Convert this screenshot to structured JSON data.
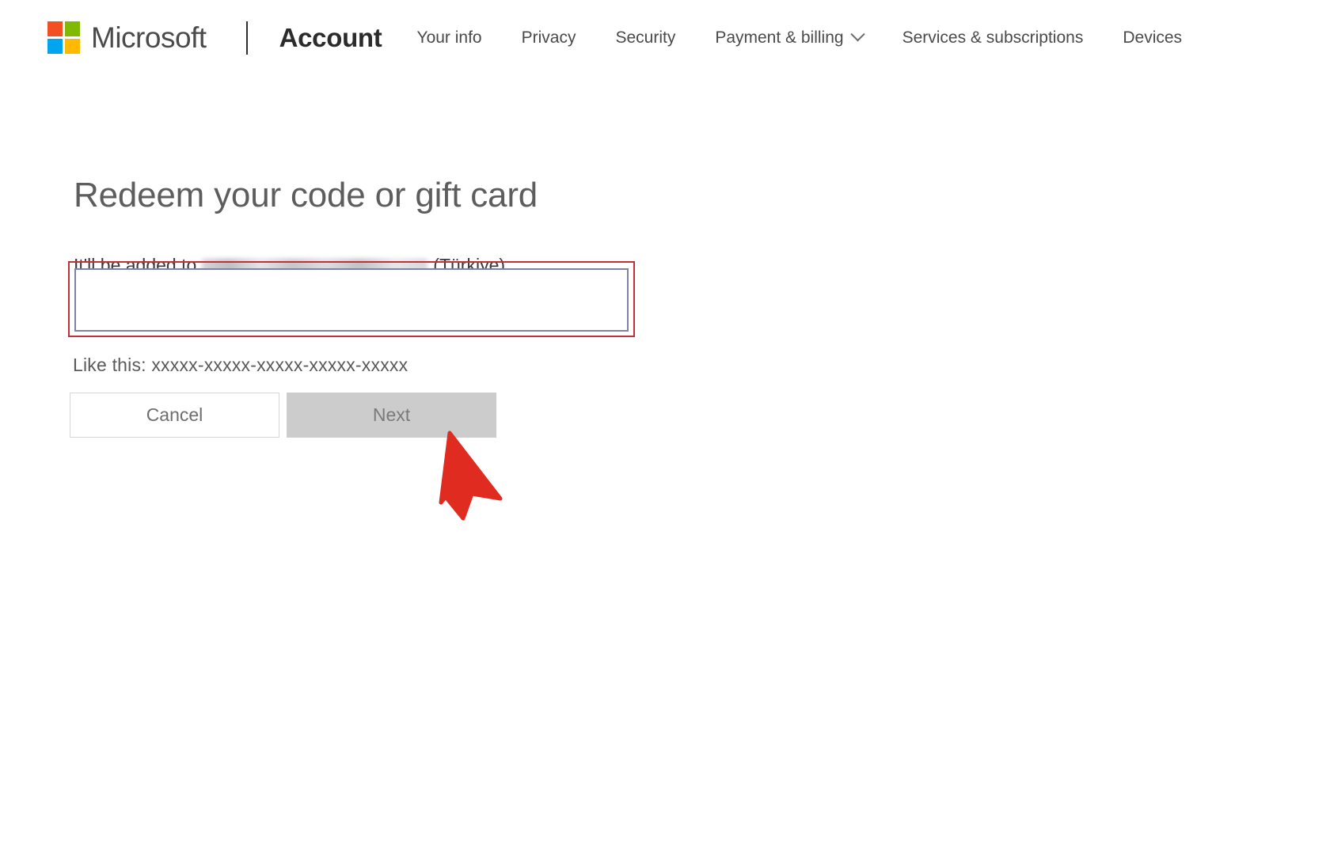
{
  "header": {
    "logo_name": "Microsoft",
    "brand_label": "Microsoft",
    "app_title": "Account",
    "logo_colors": {
      "top_left": "#f25022",
      "top_right": "#7fba00",
      "bottom_left": "#00a4ef",
      "bottom_right": "#ffb900"
    },
    "nav_items": [
      {
        "label": "Your info",
        "has_chevron": false
      },
      {
        "label": "Privacy",
        "has_chevron": false
      },
      {
        "label": "Security",
        "has_chevron": false
      },
      {
        "label": "Payment & billing",
        "has_chevron": true
      },
      {
        "label": "Services & subscriptions",
        "has_chevron": false
      },
      {
        "label": "Devices",
        "has_chevron": false
      }
    ]
  },
  "main": {
    "title": "Redeem your code or gift card",
    "subtitle_prefix": "It'll be added to",
    "subtitle_account_masked": "",
    "subtitle_region": "(Türkiye)",
    "code_input": {
      "value": "",
      "placeholder": ""
    },
    "hint": "Like this: xxxxx-xxxxx-xxxxx-xxxxx-xxxxx",
    "buttons": {
      "cancel_label": "Cancel",
      "next_label": "Next"
    }
  },
  "annotations": {
    "highlight_color": "#c0303b",
    "arrow_color": "#e02b20",
    "arrow_target": "Next"
  }
}
